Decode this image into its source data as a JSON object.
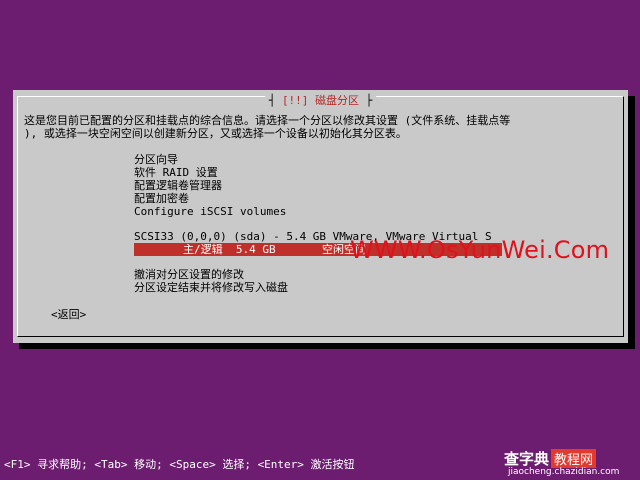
{
  "dialog": {
    "title_left_bracket": "[!!]",
    "title": "磁盘分区",
    "description_line1": "这是您目前已配置的分区和挂载点的综合信息。请选择一个分区以修改其设置 (文件系统、挂载点等",
    "description_line2": "), 或选择一块空闲空间以创建新分区，又或选择一个设备以初始化其分区表。"
  },
  "menu": {
    "items": [
      {
        "label": "分区向导"
      },
      {
        "label": "软件 RAID 设置"
      },
      {
        "label": "配置逻辑卷管理器"
      },
      {
        "label": "配置加密卷"
      },
      {
        "label": "Configure iSCSI volumes"
      }
    ]
  },
  "disk": {
    "device_line": "SCSI33 (0,0,0) (sda) - 5.4 GB VMware, VMware Virtual S",
    "free_space_line": "主/逻辑  5.4 GB       空闲空间"
  },
  "actions": {
    "undo": "撤消对分区设置的修改",
    "finish": "分区设定结束并将修改写入磁盘"
  },
  "back_button": "<返回>",
  "watermark": "WWW.OsYunWei.Com",
  "statusbar": "<F1> 寻求帮助; <Tab> 移动; <Space> 选择; <Enter> 激活按钮",
  "logo": {
    "main": "查字典",
    "tag": "教程网",
    "sub": "jiaocheng.chazidian.com"
  },
  "colors": {
    "background": "#6c1d70",
    "dialog": "#c9c9c9",
    "selection": "#c0302b",
    "title": "#b52727",
    "watermark": "#e0111b"
  }
}
